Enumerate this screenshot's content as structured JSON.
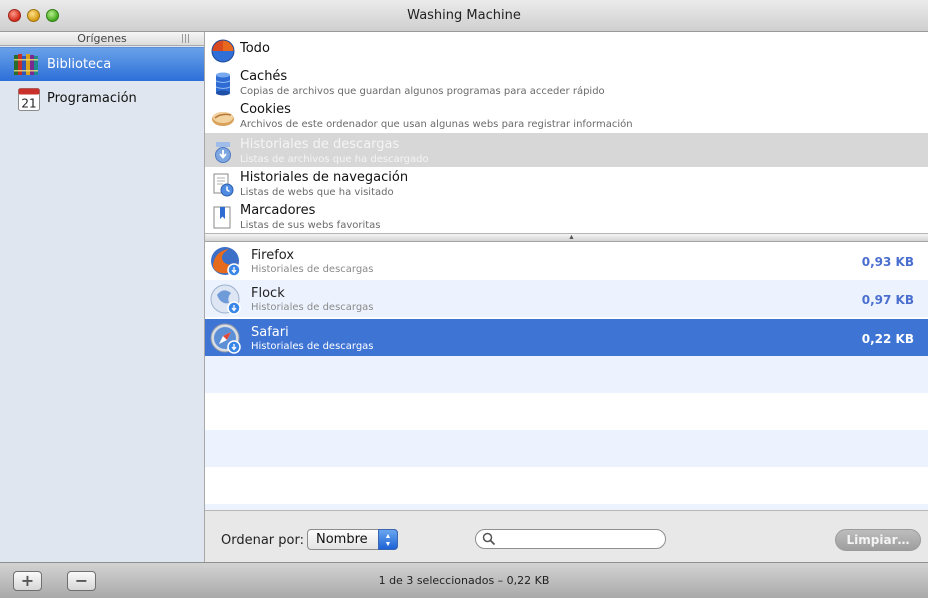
{
  "window": {
    "title": "Washing Machine"
  },
  "sidebar": {
    "header": "Orígenes",
    "items": [
      {
        "label": "Biblioteca",
        "icon": "library-books-icon",
        "selected": true
      },
      {
        "label": "Programación",
        "icon": "calendar-icon",
        "calendar_day": "21"
      }
    ]
  },
  "categories": [
    {
      "title": "Todo",
      "subtitle": "",
      "icon": "all-sphere-icon"
    },
    {
      "title": "Cachés",
      "subtitle": "Copias de archivos que guardan algunos programas para acceder rápido",
      "icon": "database-icon"
    },
    {
      "title": "Cookies",
      "subtitle": "Archivos de este ordenador que usan algunas webs para registrar información",
      "icon": "cookie-icon"
    },
    {
      "title": "Historiales de descargas",
      "subtitle": "Listas de archivos que ha descargado",
      "icon": "download-history-icon",
      "selected": true
    },
    {
      "title": "Historiales de navegación",
      "subtitle": "Listas de webs que ha visitado",
      "icon": "browsing-history-icon"
    },
    {
      "title": "Marcadores",
      "subtitle": "Listas de sus webs favoritas",
      "icon": "bookmark-icon"
    }
  ],
  "browsers": [
    {
      "name": "Firefox",
      "subtitle": "Historiales de descargas",
      "size": "0,93 KB",
      "icon": "firefox-icon"
    },
    {
      "name": "Flock",
      "subtitle": "Historiales de descargas",
      "size": "0,97 KB",
      "icon": "flock-icon"
    },
    {
      "name": "Safari",
      "subtitle": "Historiales de descargas",
      "size": "0,22 KB",
      "icon": "safari-icon",
      "selected": true
    }
  ],
  "controls": {
    "sort_label": "Ordenar por:",
    "sort_value": "Nombre",
    "search_value": "",
    "clear_label": "Limpiar…"
  },
  "bottom": {
    "add_label": "+",
    "remove_label": "−",
    "status": "1 de 3 seleccionados – 0,22 KB"
  },
  "colors": {
    "selection_blue": "#3e74d4",
    "size_text": "#4b6fcf",
    "sidebar_bg": "#dfe6ef"
  }
}
